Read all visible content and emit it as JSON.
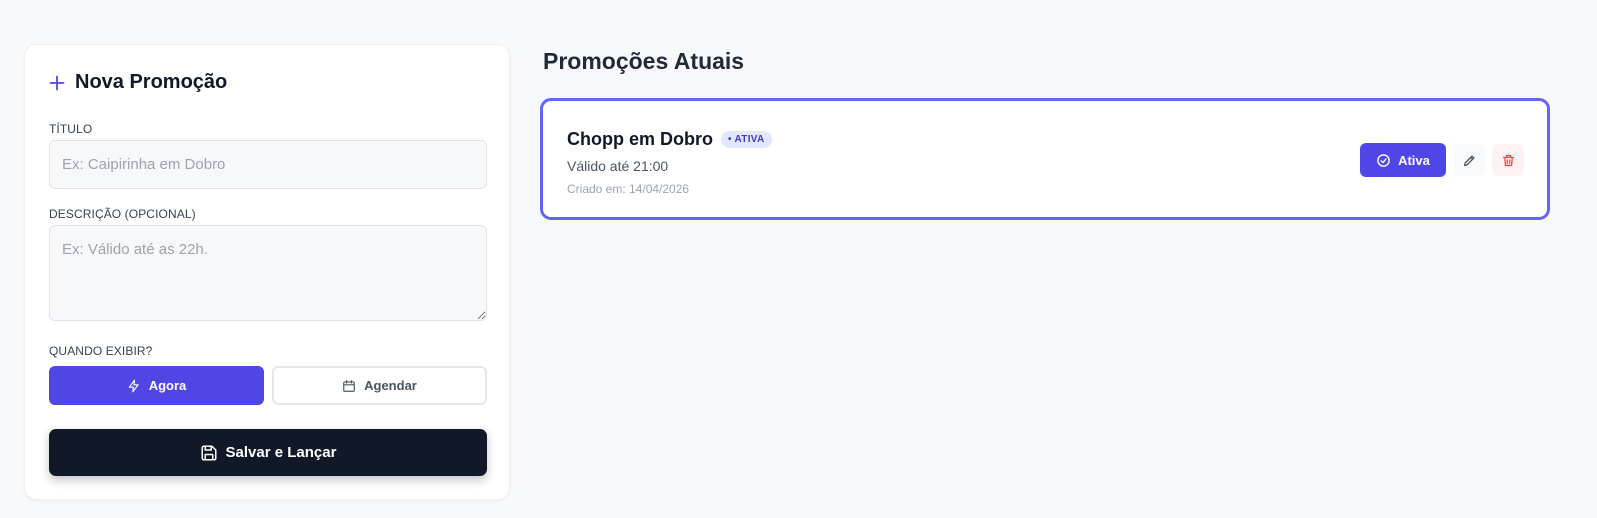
{
  "form": {
    "title": "Nova Promoção",
    "title_field": {
      "label": "TÍTULO",
      "placeholder": "Ex: Caipirinha em Dobro",
      "value": ""
    },
    "description_field": {
      "label": "DESCRIÇÃO (OPCIONAL)",
      "placeholder": "Ex: Válido até as 22h.",
      "value": ""
    },
    "when": {
      "label": "QUANDO EXIBIR?",
      "options": [
        {
          "label": "Agora",
          "icon": "bolt-icon",
          "selected": true
        },
        {
          "label": "Agendar",
          "icon": "calendar-icon",
          "selected": false
        }
      ]
    },
    "save_label": "Salvar e Lançar",
    "save_icon": "save-icon"
  },
  "promotions": {
    "title": "Promoções Atuais",
    "items": [
      {
        "name": "Chopp em Dobro",
        "badge": "• ATIVA",
        "description": "Válido até 21:00",
        "created": "Criado em: 14/04/2026",
        "status_button": "Ativa"
      }
    ]
  },
  "colors": {
    "accent": "#4f46e5",
    "card_border": "#6366f1",
    "dark": "#111827",
    "danger": "#ef4444",
    "background": "#f8f9fb"
  }
}
